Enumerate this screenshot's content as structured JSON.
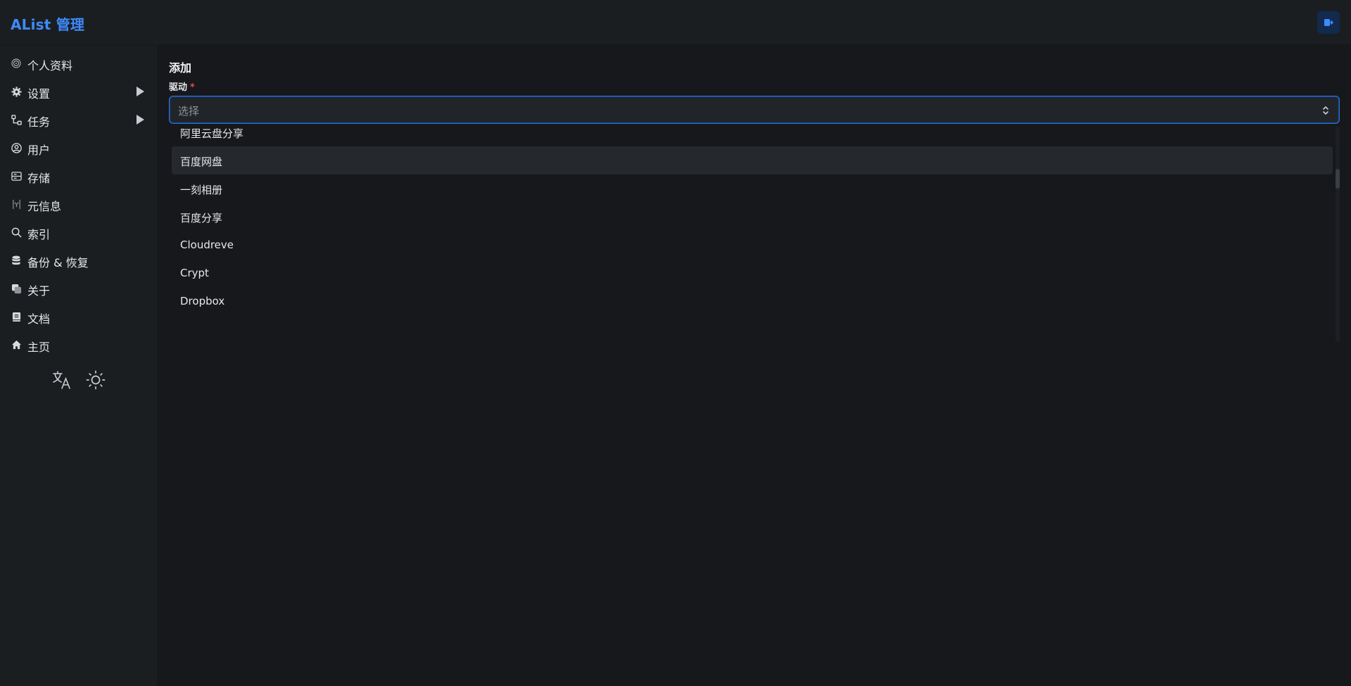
{
  "app": {
    "title": "AList 管理"
  },
  "header": {
    "logout_icon": "logout-icon"
  },
  "sidebar": {
    "items": [
      {
        "label": "个人资料",
        "icon": "fingerprint-icon"
      },
      {
        "label": "设置",
        "icon": "gear-icon",
        "expandable": true
      },
      {
        "label": "任务",
        "icon": "workflow-icon",
        "expandable": true
      },
      {
        "label": "用户",
        "icon": "user-circle-icon"
      },
      {
        "label": "存储",
        "icon": "storage-icon"
      },
      {
        "label": "元信息",
        "icon": "meta-icon"
      },
      {
        "label": "索引",
        "icon": "search-icon"
      },
      {
        "label": "备份 & 恢复",
        "icon": "database-icon"
      },
      {
        "label": "关于",
        "icon": "about-icon"
      },
      {
        "label": "文档",
        "icon": "book-icon"
      },
      {
        "label": "主页",
        "icon": "home-icon"
      }
    ],
    "bottom": {
      "language_icon": "translate-icon",
      "theme_icon": "sun-icon"
    }
  },
  "main": {
    "heading": "添加",
    "driver_label": "驱动",
    "required_mark": "*",
    "select_placeholder": "选择",
    "options": [
      "阿里云盘分享",
      "百度网盘",
      "一刻相册",
      "百度分享",
      "Cloudreve",
      "Crypt",
      "Dropbox"
    ],
    "highlighted_option": "百度网盘"
  },
  "colors": {
    "accent": "#3d8bfd",
    "background": "#16181b",
    "sidebar": "#1b1e21",
    "required": "#e5484d",
    "focus_border": "#2b6ed6"
  }
}
